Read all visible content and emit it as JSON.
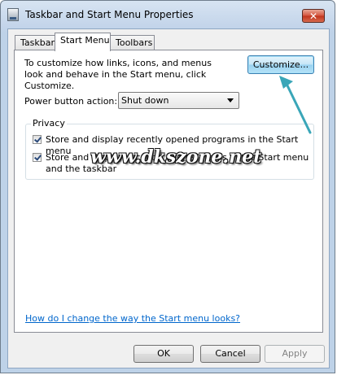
{
  "window": {
    "title": "Taskbar and Start Menu Properties",
    "close_glyph": "✕"
  },
  "tabs": [
    {
      "label": "Taskbar",
      "active": false
    },
    {
      "label": "Start Menu",
      "active": true
    },
    {
      "label": "Toolbars",
      "active": false
    }
  ],
  "start_menu": {
    "intro_text": "To customize how links, icons, and menus look and behave in the Start menu, click Customize.",
    "customize_button": "Customize...",
    "power_label": "Power button action:",
    "power_value": "Shut down",
    "privacy": {
      "title": "Privacy",
      "options": [
        {
          "label": "Store and display recently opened programs in the Start menu",
          "checked": true
        },
        {
          "label": "Store and display recently opened items in the Start menu and the taskbar",
          "checked": true
        }
      ]
    },
    "help_link": "How do I change the way the Start menu looks?"
  },
  "footer": {
    "ok": "OK",
    "cancel": "Cancel",
    "apply": "Apply"
  },
  "watermark": "www.dkszone.net",
  "colors": {
    "annotation_arrow": "#3aa6b8",
    "link": "#0066cc"
  }
}
